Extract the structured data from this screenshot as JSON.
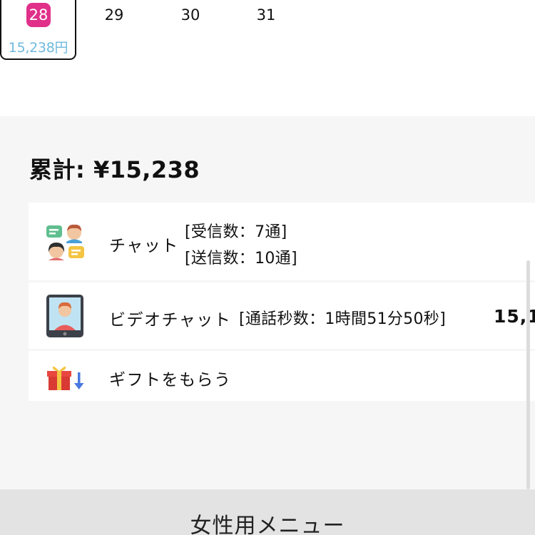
{
  "calendar": {
    "selected_day": {
      "day": "28",
      "amount": "15,238円"
    },
    "days": [
      "29",
      "30",
      "31"
    ]
  },
  "summary": {
    "total": "累計: ¥15,238",
    "rows": [
      {
        "label": "チャット",
        "details": [
          "[受信数：7通]",
          "[送信数：10通]"
        ],
        "icon": "chat-people-icon"
      },
      {
        "label": "ビデオチャット",
        "details": [
          "[通話秒数：1時間51分50秒]"
        ],
        "amount": "15,1",
        "icon": "video-tablet-icon"
      },
      {
        "label": "ギフトをもらう",
        "details": [],
        "icon": "gift-receive-icon"
      }
    ]
  },
  "bottom_menu": {
    "label": "女性用メニュー"
  },
  "colors": {
    "accent": "#e0308a",
    "amount_text": "#6fb8de",
    "section_bg": "#f6f6f6"
  }
}
